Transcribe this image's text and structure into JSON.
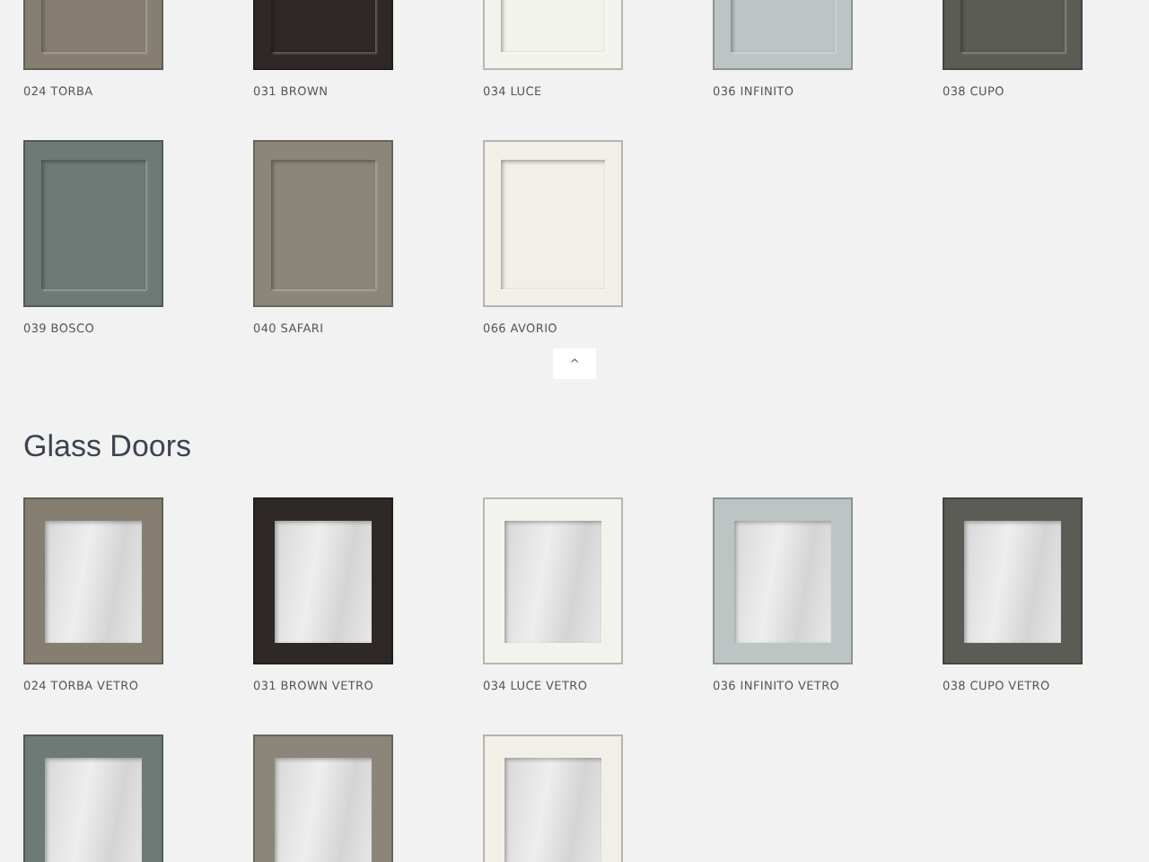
{
  "panel_doors": {
    "items": [
      {
        "label": "024 TORBA",
        "color": "#857e71"
      },
      {
        "label": "031 BROWN",
        "color": "#2e2926"
      },
      {
        "label": "034 LUCE",
        "color": "#f3f3ee"
      },
      {
        "label": "036 INFINITO",
        "color": "#bcc5c4"
      },
      {
        "label": "038 CUPO",
        "color": "#5a5c55"
      },
      {
        "label": "039 BOSCO",
        "color": "#6d7a76"
      },
      {
        "label": "040 SAFARI",
        "color": "#8c8579"
      },
      {
        "label": "066 AVORIO",
        "color": "#f1efe8"
      }
    ],
    "back_button": "^"
  },
  "glass_doors": {
    "heading": "Glass Doors",
    "items": [
      {
        "label": "024 TORBA VETRO",
        "color": "#857e71"
      },
      {
        "label": "031 BROWN VETRO",
        "color": "#2e2926"
      },
      {
        "label": "034 LUCE VETRO",
        "color": "#f3f3ee"
      },
      {
        "label": "036 INFINITO VETRO",
        "color": "#bcc5c4"
      },
      {
        "label": "038 CUPO VETRO",
        "color": "#5a5c55"
      },
      {
        "color": "#6d7a76"
      },
      {
        "color": "#8c8579"
      },
      {
        "color": "#f1efe8"
      }
    ]
  }
}
